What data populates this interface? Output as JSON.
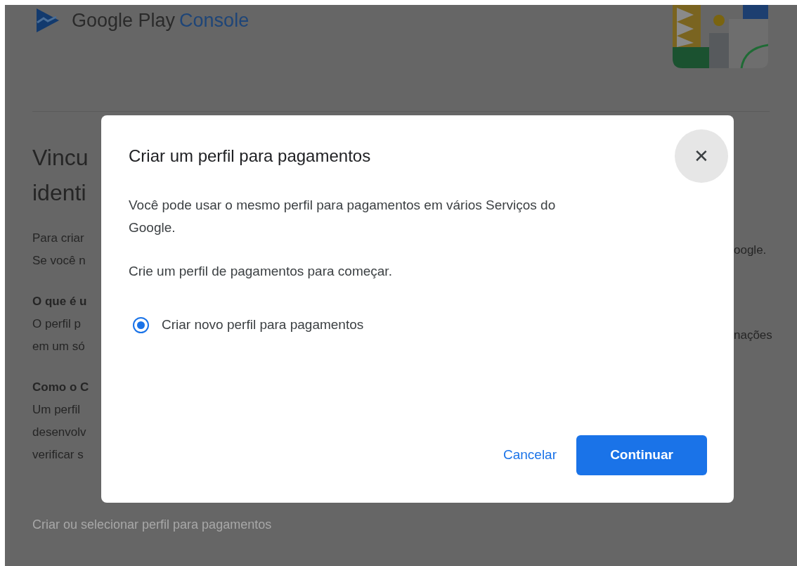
{
  "header": {
    "brand": "Google Play",
    "product": "Console"
  },
  "page_left": {
    "heading_lines": [
      "Vincu",
      "identi"
    ],
    "paragraphs": [
      {
        "lines": [
          {
            "text": "Para criar",
            "bold": false
          },
          {
            "text": "Se você n",
            "bold": false
          }
        ]
      },
      {
        "lines": [
          {
            "text": "O que é u",
            "bold": true
          },
          {
            "text": "O perfil p",
            "bold": false
          },
          {
            "text": "em um só",
            "bold": false
          }
        ]
      },
      {
        "lines": [
          {
            "text": "Como o C",
            "bold": true
          },
          {
            "text": "Um perfil",
            "bold": false
          },
          {
            "text": "desenvolv",
            "bold": false
          },
          {
            "text": "verificar s",
            "bold": false
          }
        ]
      }
    ]
  },
  "page_right": {
    "lines": [
      "oogle.",
      "nações"
    ]
  },
  "page_link": "Criar ou selecionar perfil para pagamentos",
  "dialog": {
    "title": "Criar um perfil para pagamentos",
    "close": "✕",
    "paragraphs": [
      "Você pode usar o mesmo perfil para pagamentos em vários Serviços do Google.",
      "Crie um perfil de pagamentos para começar."
    ],
    "options": [
      {
        "label": "Criar novo perfil para pagamentos",
        "selected": true
      }
    ],
    "buttons": [
      {
        "label": "Cancelar",
        "kind": "text"
      },
      {
        "label": "Continuar",
        "kind": "filled"
      }
    ]
  }
}
